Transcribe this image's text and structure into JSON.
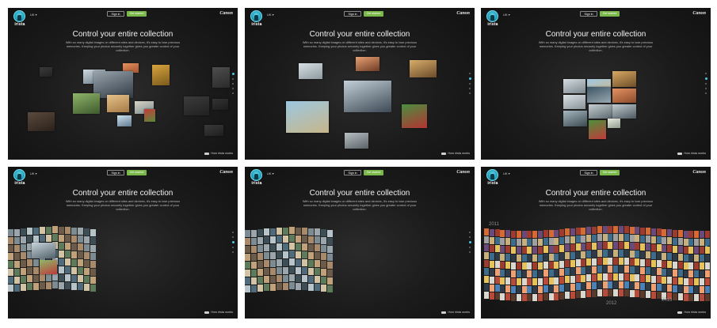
{
  "header": {
    "app_name": "irista",
    "region": "UK",
    "sign_in": "Sign in",
    "get_started": "Get started",
    "brand": "Canon"
  },
  "hero": {
    "title": "Control your entire collection",
    "body": "With so many digital images on different sites and devices, it's easy to lose precious memories. Keeping your photos securely together gives you greater control of your collection."
  },
  "footer": {
    "how_it_works": "How irista works"
  },
  "years": [
    "2011",
    "2012",
    "2013"
  ],
  "colors": {
    "accent_green": "#7bb84a",
    "accent_blue": "#4fc6e3",
    "panel_bg": "#1a1a1a"
  }
}
